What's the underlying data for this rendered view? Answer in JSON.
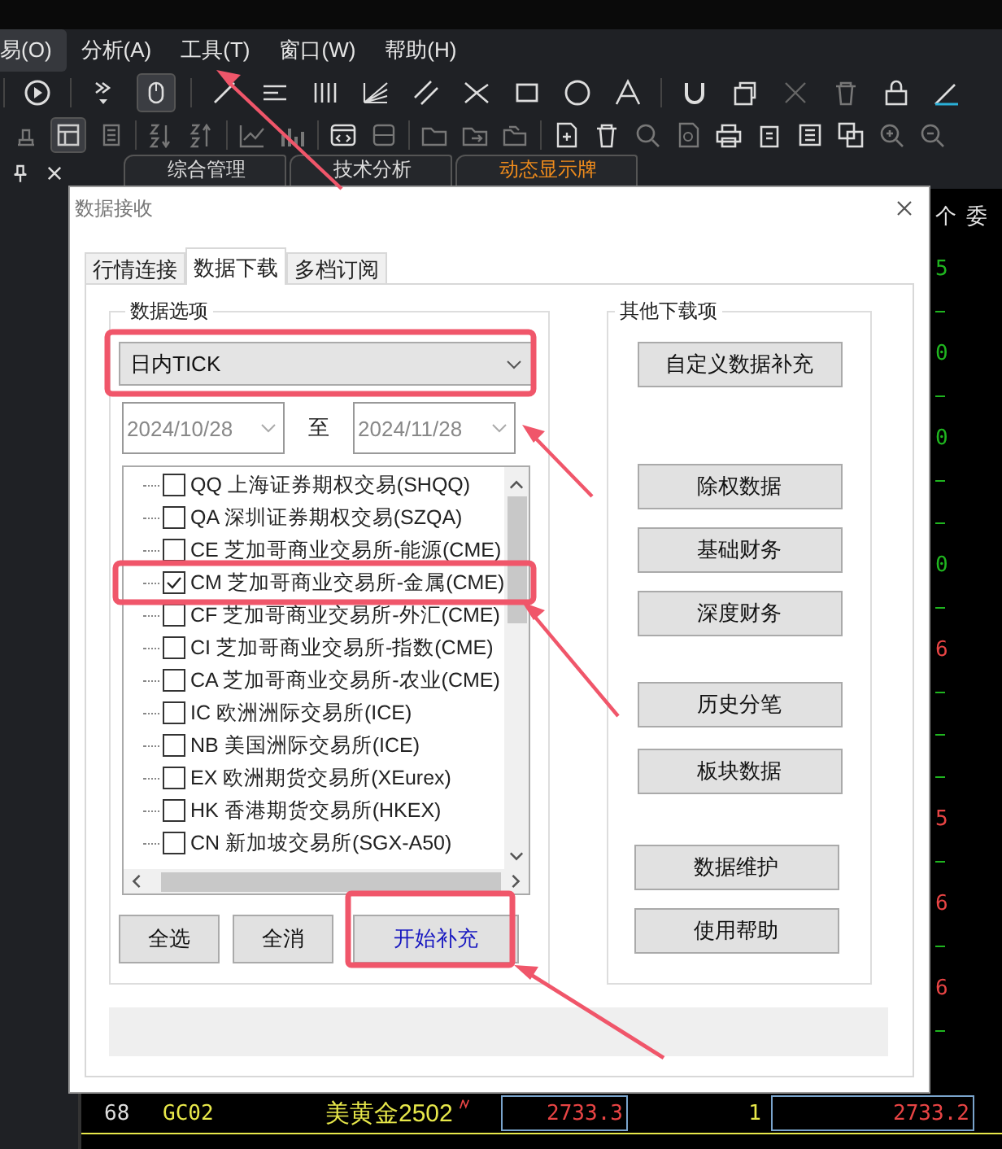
{
  "menu": [
    {
      "label": "易(O)",
      "selected": true
    },
    {
      "label": "分析(A)",
      "selected": false
    },
    {
      "label": "工具(T)",
      "selected": false
    },
    {
      "label": "窗口(W)",
      "selected": false
    },
    {
      "label": "帮助(H)",
      "selected": false
    }
  ],
  "doc_tabs": [
    {
      "label": "综合管理",
      "selected": false
    },
    {
      "label": "技术分析",
      "selected": false
    },
    {
      "label": "动态显示牌",
      "selected": true
    }
  ],
  "grid_header": [
    "个",
    "委"
  ],
  "edge_column": [
    {
      "kind": "value",
      "value": "5",
      "color": "#1fb51f"
    },
    {
      "kind": "tick"
    },
    {
      "kind": "value",
      "value": "0",
      "color": "#1fb51f"
    },
    {
      "kind": "tick"
    },
    {
      "kind": "value",
      "value": "0",
      "color": "#1fb51f"
    },
    {
      "kind": "tick"
    },
    {
      "kind": "tick"
    },
    {
      "kind": "value",
      "value": "0",
      "color": "#1fb51f"
    },
    {
      "kind": "tick"
    },
    {
      "kind": "value",
      "value": "6",
      "color": "#e84444"
    },
    {
      "kind": "tick"
    },
    {
      "kind": "tick"
    },
    {
      "kind": "tick"
    },
    {
      "kind": "value",
      "value": "5",
      "color": "#e84444"
    },
    {
      "kind": "tick"
    },
    {
      "kind": "value",
      "value": "6",
      "color": "#e84444"
    },
    {
      "kind": "tick"
    },
    {
      "kind": "value",
      "value": "6",
      "color": "#e84444"
    },
    {
      "kind": "tick"
    }
  ],
  "rows": [
    {
      "no": "68",
      "code": "GC02",
      "name": "美黄金2502",
      "price": "2733.3",
      "volume": "1",
      "price_2": "2733.2"
    }
  ],
  "dialog": {
    "title": "数据接收",
    "tabs": [
      {
        "label": "行情连接",
        "selected": false
      },
      {
        "label": "数据下载",
        "selected": true
      },
      {
        "label": "多档订阅",
        "selected": false
      }
    ],
    "data_options": {
      "title": "数据选项",
      "type": "日内TICK",
      "date_from": "2024/10/28",
      "date_sep": "至",
      "date_to": "2024/11/28",
      "exchanges": [
        {
          "label": "QQ 上海证券期权交易(SHQQ)",
          "checked": false
        },
        {
          "label": "QA 深圳证券期权交易(SZQA)",
          "checked": false
        },
        {
          "label": "CE 芝加哥商业交易所-能源(CME)",
          "checked": false
        },
        {
          "label": "CM 芝加哥商业交易所-金属(CME)",
          "checked": true
        },
        {
          "label": "CF 芝加哥商业交易所-外汇(CME)",
          "checked": false
        },
        {
          "label": "CI 芝加哥商业交易所-指数(CME)",
          "checked": false
        },
        {
          "label": "CA 芝加哥商业交易所-农业(CME)",
          "checked": false
        },
        {
          "label": "IC 欧洲洲际交易所(ICE)",
          "checked": false
        },
        {
          "label": "NB 美国洲际交易所(ICE)",
          "checked": false
        },
        {
          "label": "EX 欧洲期货交易所(XEurex)",
          "checked": false
        },
        {
          "label": "HK 香港期货交易所(HKEX)",
          "checked": false
        },
        {
          "label": "CN 新加坡交易所(SGX-A50)",
          "checked": false
        }
      ],
      "buttons": [
        {
          "label": "全选",
          "primary": false
        },
        {
          "label": "全消",
          "primary": false
        },
        {
          "label": "开始补充",
          "primary": true
        }
      ]
    },
    "other": {
      "title": "其他下载项",
      "groups": [
        [
          "自定义数据补充"
        ],
        [
          "除权数据",
          "基础财务",
          "深度财务"
        ],
        [
          "历史分笔",
          "板块数据"
        ],
        [
          "数据维护",
          "使用帮助"
        ]
      ]
    }
  }
}
